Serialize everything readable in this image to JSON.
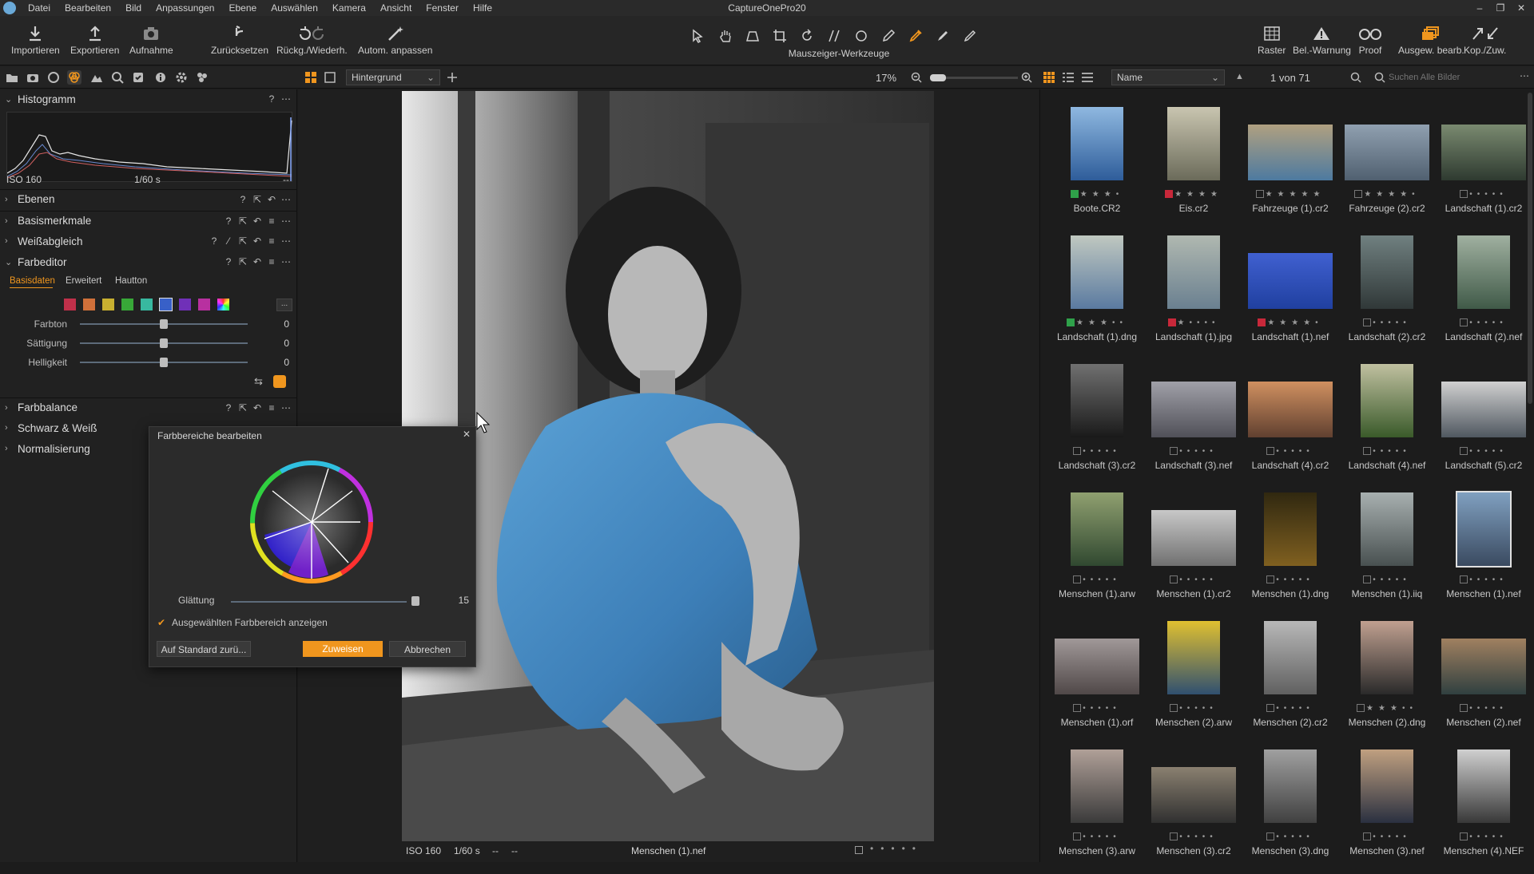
{
  "window": {
    "title": "CaptureOnePro20",
    "controls": [
      "–",
      "❐",
      "✕"
    ]
  },
  "menu": [
    "Datei",
    "Bearbeiten",
    "Bild",
    "Anpassungen",
    "Ebene",
    "Auswählen",
    "Kamera",
    "Ansicht",
    "Fenster",
    "Hilfe"
  ],
  "toolbar": {
    "import": "Importieren",
    "export": "Exportieren",
    "capture": "Aufnahme",
    "reset": "Zurücksetzen",
    "undo_redo": "Rückg./Wiederh.",
    "auto_adjust": "Autom. anpassen",
    "cursor_tools": "Mauszeiger-Werkzeuge",
    "grid": "Raster",
    "exposure_warning": "Bel.-Warnung",
    "proof": "Proof",
    "edit_selected": "Ausgew. bearb.",
    "copy_apply": "Kop./Zuw."
  },
  "viewer_bar": {
    "layer_select": "Hintergrund",
    "zoom": "17%"
  },
  "browser_bar": {
    "sort": "Name",
    "count": "1 von 71",
    "search_placeholder": "Suchen Alle Bilder"
  },
  "left_panel": {
    "histogram": {
      "title": "Histogramm",
      "iso": "ISO 160",
      "shutter": "1/60 s",
      "dash": "--"
    },
    "sections": {
      "layers": "Ebenen",
      "basic": "Basismerkmale",
      "white_balance": "Weißabgleich",
      "color_editor": "Farbeditor",
      "color_balance": "Farbbalance",
      "bw": "Schwarz & Weiß",
      "normalize": "Normalisierung"
    },
    "color_editor": {
      "tabs": [
        "Basisdaten",
        "Erweitert",
        "Hautton"
      ],
      "more": "...",
      "sliders": [
        {
          "label": "Farbton",
          "value": "0"
        },
        {
          "label": "Sättigung",
          "value": "0"
        },
        {
          "label": "Helligkeit",
          "value": "0"
        }
      ],
      "swatch_colors": [
        "#c0304a",
        "#d0703a",
        "#c8b030",
        "#38a838",
        "#38b8a0",
        "#3860c8",
        "#7030b8",
        "#b830a0"
      ]
    }
  },
  "dialog": {
    "title": "Farbbereiche bearbeiten",
    "close": "✕",
    "smoothing_label": "Glättung",
    "smoothing_value": "15",
    "checkbox_label": "Ausgewählten Farbbereich anzeigen",
    "reset_button": "Auf Standard zurü...",
    "apply_button": "Zuweisen",
    "cancel_button": "Abbrechen"
  },
  "viewer_footer": {
    "iso": "ISO 160",
    "shutter": "1/60 s",
    "dash1": "--",
    "dash2": "--",
    "filename": "Menschen (1).nef"
  },
  "thumbnails": [
    {
      "name": "Boote.CR2",
      "stars": "★★★•",
      "tag": "#2fa14a"
    },
    {
      "name": "Eis.cr2",
      "stars": "★★★★",
      "tag": "#c8283a"
    },
    {
      "name": "Fahrzeuge (1).cr2",
      "stars": "★★★★★",
      "tag": ""
    },
    {
      "name": "Fahrzeuge (2).cr2",
      "stars": "★★★★•",
      "tag": ""
    },
    {
      "name": "Landschaft (1).cr2",
      "stars": "•••••",
      "tag": ""
    },
    {
      "name": "Landschaft (1).dng",
      "stars": "★★★••",
      "tag": "#2fa14a"
    },
    {
      "name": "Landschaft (1).jpg",
      "stars": "★••••",
      "tag": "#c8283a"
    },
    {
      "name": "Landschaft (1).nef",
      "stars": "★★★★•",
      "tag": "#c8283a"
    },
    {
      "name": "Landschaft (2).cr2",
      "stars": "•••••",
      "tag": ""
    },
    {
      "name": "Landschaft (2).nef",
      "stars": "•••••",
      "tag": ""
    },
    {
      "name": "Landschaft (3).cr2",
      "stars": "•••••",
      "tag": ""
    },
    {
      "name": "Landschaft (3).nef",
      "stars": "•••••",
      "tag": ""
    },
    {
      "name": "Landschaft (4).cr2",
      "stars": "•••••",
      "tag": ""
    },
    {
      "name": "Landschaft (4).nef",
      "stars": "•••••",
      "tag": ""
    },
    {
      "name": "Landschaft (5).cr2",
      "stars": "•••••",
      "tag": ""
    },
    {
      "name": "Menschen (1).arw",
      "stars": "•••••",
      "tag": ""
    },
    {
      "name": "Menschen (1).cr2",
      "stars": "•••••",
      "tag": ""
    },
    {
      "name": "Menschen (1).dng",
      "stars": "•••••",
      "tag": ""
    },
    {
      "name": "Menschen (1).iiq",
      "stars": "•••••",
      "tag": ""
    },
    {
      "name": "Menschen (1).nef",
      "stars": "•••••",
      "tag": ""
    },
    {
      "name": "Menschen (1).orf",
      "stars": "•••••",
      "tag": ""
    },
    {
      "name": "Menschen (2).arw",
      "stars": "•••••",
      "tag": ""
    },
    {
      "name": "Menschen (2).cr2",
      "stars": "•••••",
      "tag": ""
    },
    {
      "name": "Menschen (2).dng",
      "stars": "★★★••",
      "tag": ""
    },
    {
      "name": "Menschen (2).nef",
      "stars": "•••••",
      "tag": ""
    },
    {
      "name": "Menschen (3).arw",
      "stars": "•••••",
      "tag": ""
    },
    {
      "name": "Menschen (3).cr2",
      "stars": "•••••",
      "tag": ""
    },
    {
      "name": "Menschen (3).dng",
      "stars": "•••••",
      "tag": ""
    },
    {
      "name": "Menschen (3).nef",
      "stars": "•••••",
      "tag": ""
    },
    {
      "name": "Menschen (4).NEF",
      "stars": "•••••",
      "tag": ""
    }
  ],
  "colors": {
    "accent": "#f0961e",
    "panel_bg": "#212121",
    "selection_border": "#e0e0e0"
  }
}
